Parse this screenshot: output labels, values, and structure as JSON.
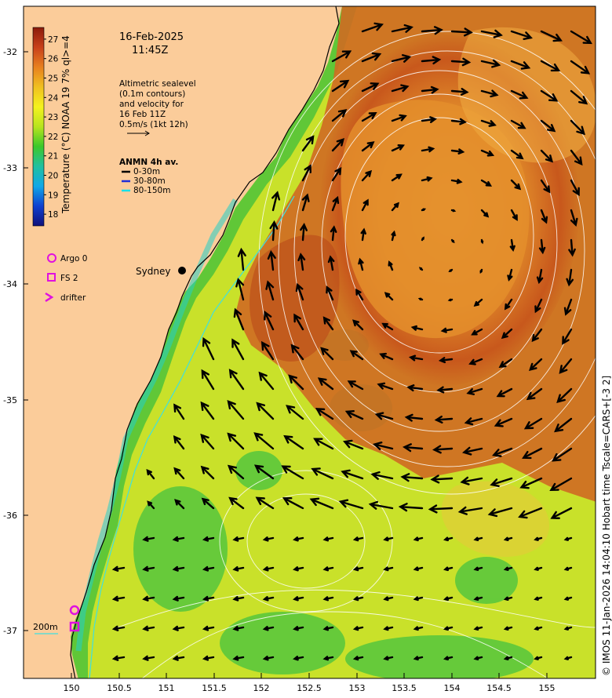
{
  "map": {
    "date": "16-Feb-2025",
    "time": "11:45Z",
    "altimetry_note": [
      "Altimetric sealevel",
      "(0.1m contours)",
      "and velocity for",
      "16 Feb 11Z",
      "0.5m/s (1kt 12h)"
    ],
    "anmn_title": "ANMN 4h av.",
    "anmn_items": [
      {
        "label": "0-30m",
        "color": "#000000"
      },
      {
        "label": "30-80m",
        "color": "#1f2fd8"
      },
      {
        "label": "80-150m",
        "color": "#18e0e8"
      }
    ],
    "colorbar": {
      "title": "Temperature (°C) NOAA 19 7% ql>=4",
      "ticks": [
        "27",
        "26",
        "25",
        "24",
        "23",
        "22",
        "21",
        "20",
        "19",
        "18"
      ],
      "min": 17.4,
      "max": 27.6
    },
    "markers": [
      {
        "label": "Argo 0",
        "shape": "circle",
        "color": "#e010e0"
      },
      {
        "label": "FS 2",
        "shape": "square",
        "color": "#e010e0"
      },
      {
        "label": "drifter",
        "shape": "chevron",
        "color": "#e010e0"
      }
    ],
    "city": "Sydney",
    "depth_label": "200m",
    "credit": "© IMOS 11-Jan-2026 14:04:10 Hobart time Tscale=CARS+[-3 2]",
    "lat_ticks": [
      "-32",
      "-33",
      "-34",
      "-35",
      "-36",
      "-37"
    ],
    "lon_ticks": [
      "150",
      "150.5",
      "151",
      "151.5",
      "152",
      "152.5",
      "153",
      "153.5",
      "154",
      "154.5",
      "155"
    ]
  }
}
